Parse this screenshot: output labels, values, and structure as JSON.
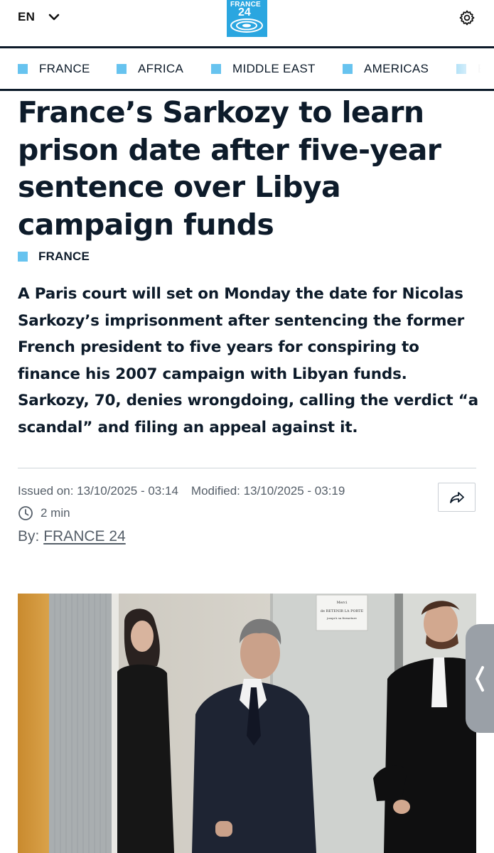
{
  "header": {
    "language": "EN",
    "logo_line1": "FRANCE",
    "logo_line2": "24",
    "icons": [
      "chevron-down-icon",
      "settings-gear-icon"
    ]
  },
  "nav": {
    "categories": [
      "FRANCE",
      "AFRICA",
      "MIDDLE EAST",
      "AMERICAS",
      "EU"
    ]
  },
  "article": {
    "headline": "France’s Sarkozy to learn prison date after five-year sentence over Libya campaign funds",
    "section": "FRANCE",
    "lead": "A Paris court will set on Monday the date for Nicolas Sarkozy’s imprisonment after sentencing the former French president to five years for conspiring to finance his 2007 campaign with Libyan funds. Sarkozy, 70, denies wrongdoing, calling the verdict “a scandal” and filing an appeal against it.",
    "issued": "Issued on: 13/10/2025 - 03:14",
    "modified": "Modified: 13/10/2025 - 03:19",
    "read_time": "2 min",
    "by_label": "By:",
    "author": "FRANCE 24",
    "photo_sign_lines": [
      "Merci",
      "de RETENIR LA PORTE",
      "jusqu'à sa fermeture"
    ]
  },
  "colors": {
    "accent": "#67c3ef",
    "logo_bg": "#2aa6e0",
    "text": "#0d1b2a",
    "meta": "#555e68"
  }
}
